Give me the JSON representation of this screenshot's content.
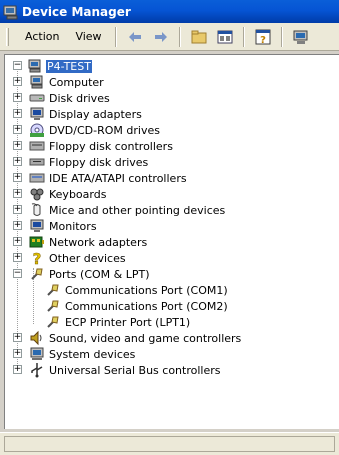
{
  "window": {
    "title": "Device Manager"
  },
  "menu": {
    "action_label": "Action",
    "view_label": "View"
  },
  "tree": {
    "root_label": "P4-TEST",
    "items": [
      {
        "label": "Computer",
        "icon": "computer-icon",
        "expander": "+"
      },
      {
        "label": "Disk drives",
        "icon": "disk-drive-icon",
        "expander": "+"
      },
      {
        "label": "Display adapters",
        "icon": "display-adapter-icon",
        "expander": "+"
      },
      {
        "label": "DVD/CD-ROM drives",
        "icon": "dvd-drive-icon",
        "expander": "+"
      },
      {
        "label": "Floppy disk controllers",
        "icon": "floppy-controller-icon",
        "expander": "+"
      },
      {
        "label": "Floppy disk drives",
        "icon": "floppy-drive-icon",
        "expander": "+"
      },
      {
        "label": "IDE ATA/ATAPI controllers",
        "icon": "ide-controller-icon",
        "expander": "+"
      },
      {
        "label": "Keyboards",
        "icon": "keyboard-icon",
        "expander": "+"
      },
      {
        "label": "Mice and other pointing devices",
        "icon": "mouse-icon",
        "expander": "+"
      },
      {
        "label": "Monitors",
        "icon": "monitor-icon",
        "expander": "+"
      },
      {
        "label": "Network adapters",
        "icon": "network-adapter-icon",
        "expander": "+"
      },
      {
        "label": "Other devices",
        "icon": "unknown-device-icon",
        "expander": "+"
      },
      {
        "label": "Ports (COM & LPT)",
        "icon": "port-icon",
        "expander": "-"
      },
      {
        "label": "Communications Port (COM1)",
        "icon": "port-icon"
      },
      {
        "label": "Communications Port (COM2)",
        "icon": "port-icon"
      },
      {
        "label": "ECP Printer Port (LPT1)",
        "icon": "port-icon"
      },
      {
        "label": "Sound, video and game controllers",
        "icon": "sound-icon",
        "expander": "+"
      },
      {
        "label": "System devices",
        "icon": "system-device-icon",
        "expander": "+"
      },
      {
        "label": "Universal Serial Bus controllers",
        "icon": "usb-icon",
        "expander": "+"
      }
    ]
  },
  "colors": {
    "title_bar": "#0654d4",
    "selection": "#316ac5",
    "chrome": "#ece9d8"
  }
}
